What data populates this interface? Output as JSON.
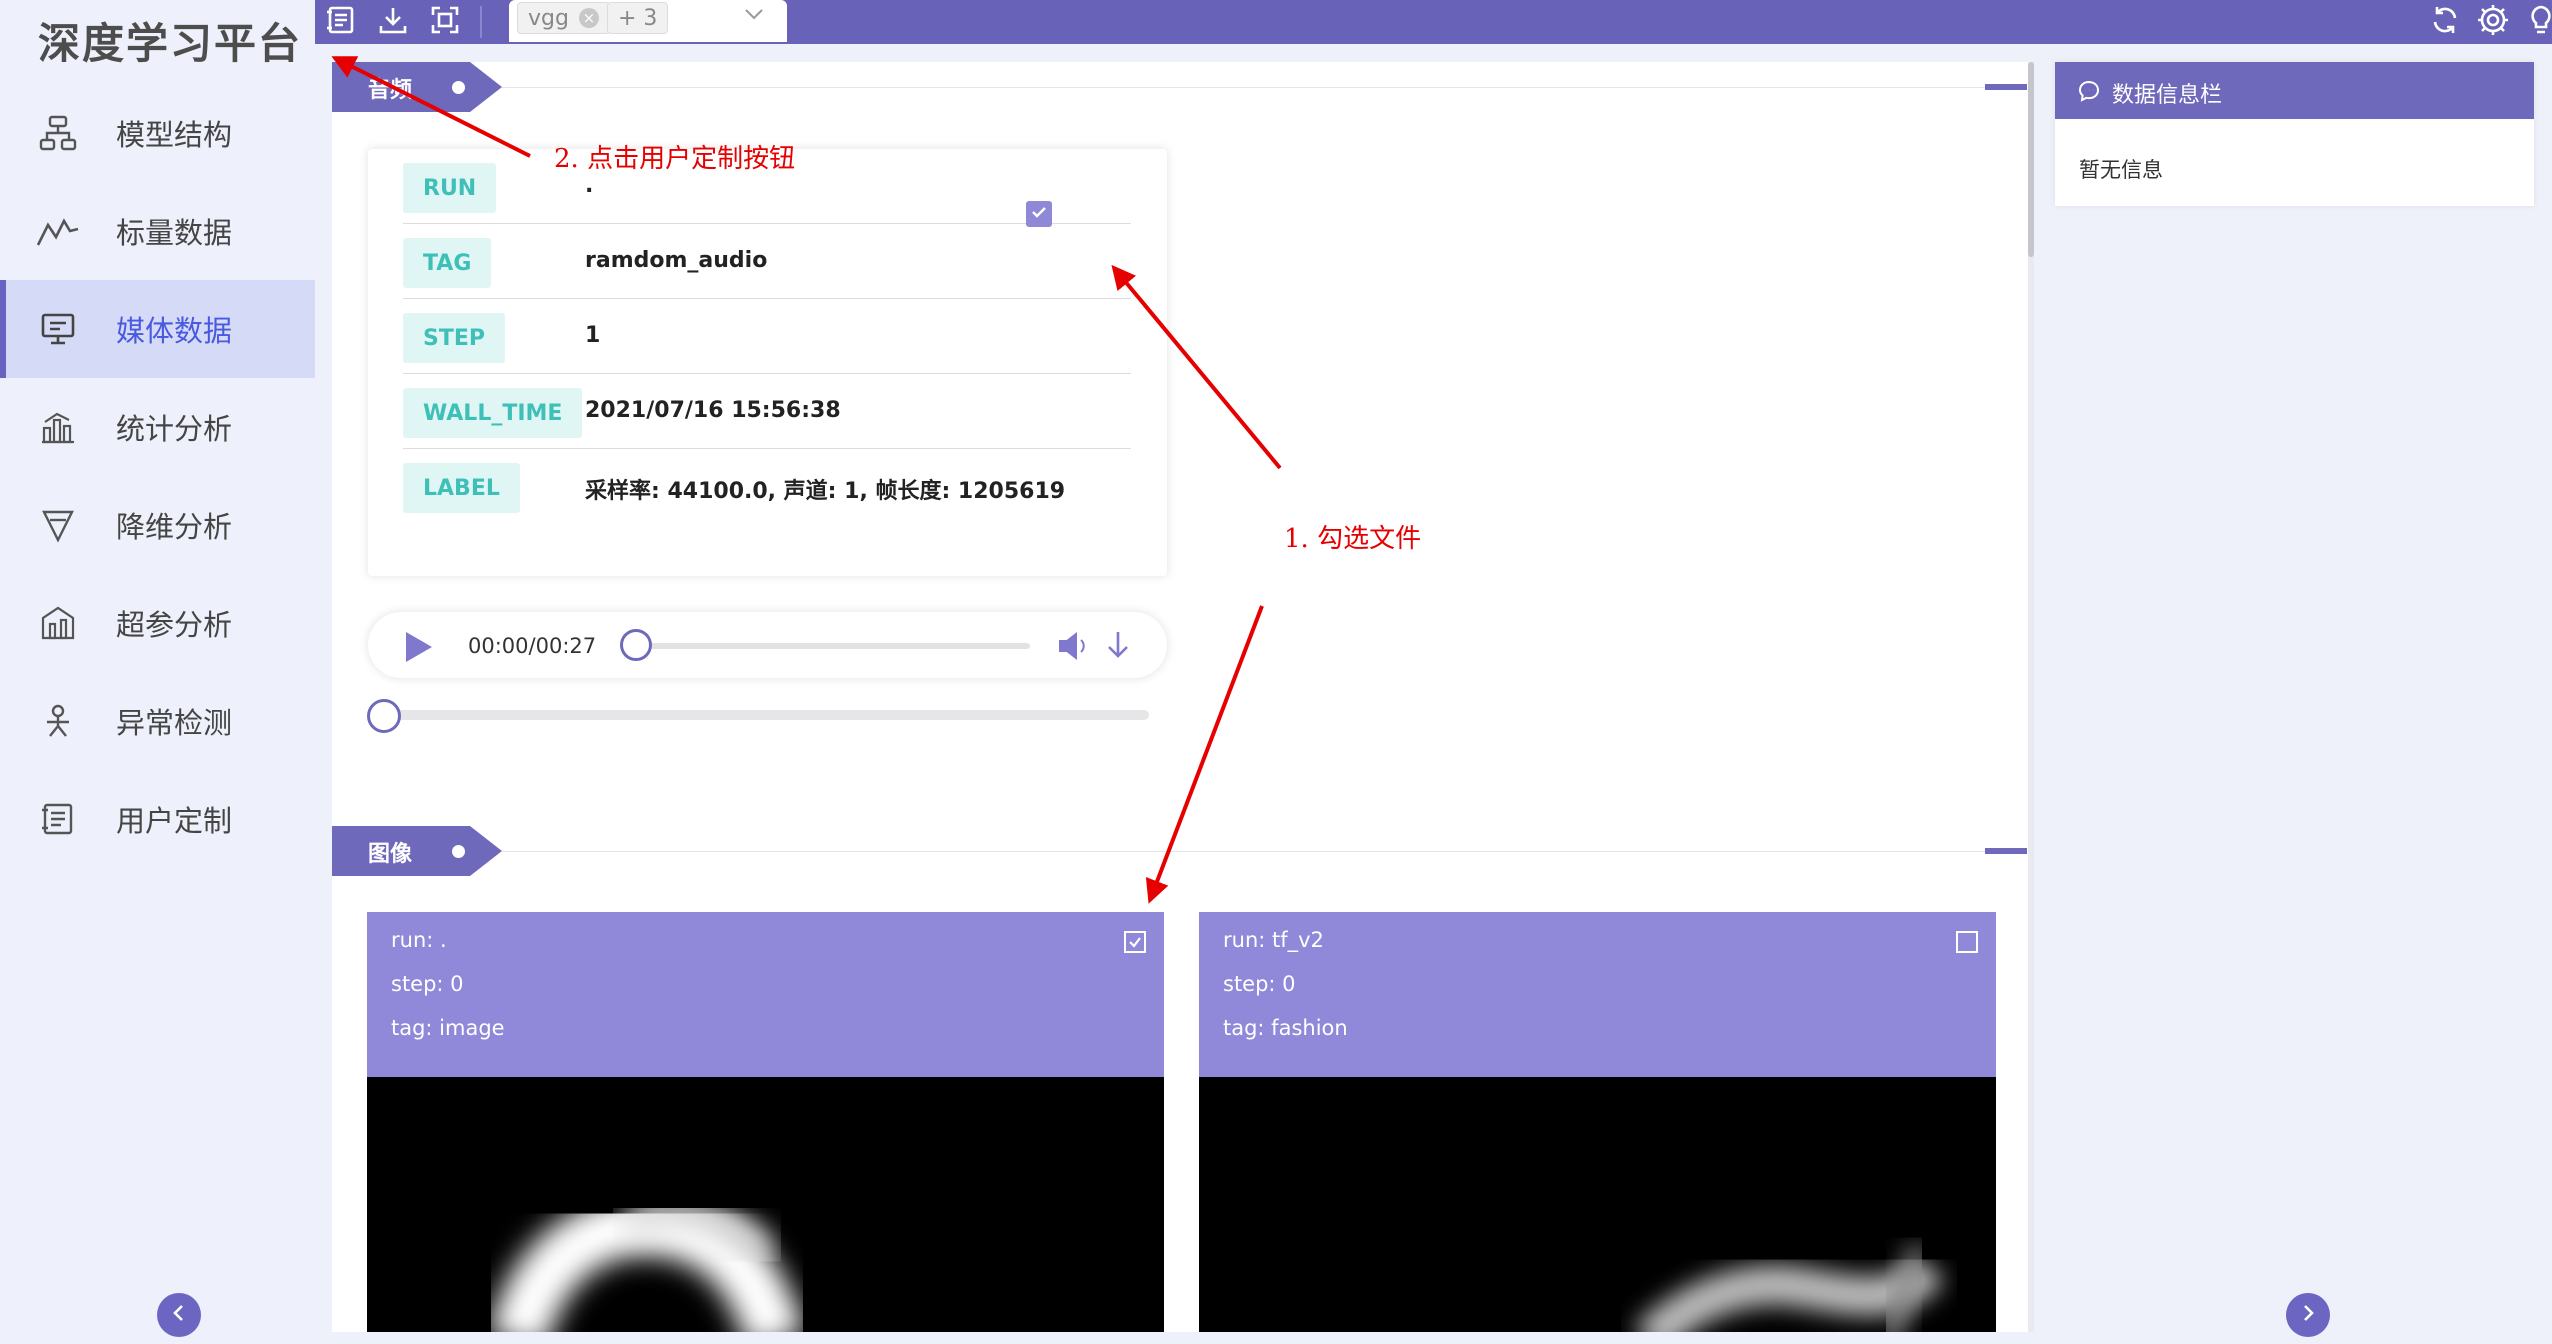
{
  "app": {
    "title": "深度学习平台"
  },
  "sidebar": {
    "items": [
      {
        "label": "模型结构",
        "icon": "model-structure-icon",
        "active": false
      },
      {
        "label": "标量数据",
        "icon": "scalar-line-icon",
        "active": false
      },
      {
        "label": "媒体数据",
        "icon": "monitor-icon",
        "active": true
      },
      {
        "label": "统计分析",
        "icon": "histogram-icon",
        "active": false
      },
      {
        "label": "降维分析",
        "icon": "funnel-icon",
        "active": false
      },
      {
        "label": "超参分析",
        "icon": "hyperparam-icon",
        "active": false
      },
      {
        "label": "异常检测",
        "icon": "anomaly-icon",
        "active": false
      },
      {
        "label": "用户定制",
        "icon": "custom-icon",
        "active": false
      }
    ]
  },
  "topbar": {
    "tools": [
      "custom-layout-icon",
      "download-icon",
      "fullscreen-icon"
    ],
    "run_select": {
      "selected": "vgg",
      "more": "+ 3"
    },
    "right_tools": [
      "refresh-icon",
      "settings-icon",
      "lightbulb-icon"
    ]
  },
  "audio_section": {
    "title": "音频",
    "info": [
      {
        "key": "RUN",
        "value": "."
      },
      {
        "key": "TAG",
        "value": "ramdom_audio"
      },
      {
        "key": "STEP",
        "value": "1"
      },
      {
        "key": "WALL_TIME",
        "value": "2021/07/16 15:56:38"
      },
      {
        "key": "LABEL",
        "value": "采样率: 44100.0, 声道: 1, 帧长度: 1205619"
      }
    ],
    "player": {
      "time": "00:00/00:27",
      "progress": 0
    }
  },
  "image_section": {
    "title": "图像",
    "cards": [
      {
        "run": "run: .",
        "step": "step: 0",
        "tag": "tag: image",
        "checked": true
      },
      {
        "run": "run: tf_v2",
        "step": "step: 0",
        "tag": "tag: fashion",
        "checked": false
      }
    ]
  },
  "info_panel": {
    "title": "数据信息栏",
    "body": "暂无信息"
  },
  "annotations": {
    "step1": "1. 勾选文件",
    "step2": "2. 点击用户定制按钮"
  },
  "colors": {
    "accent": "#6f69bc",
    "card_head": "#9089d9",
    "key_bg": "#e0f6f5",
    "key_text": "#3ec0b8",
    "annotation": "#e60000"
  }
}
